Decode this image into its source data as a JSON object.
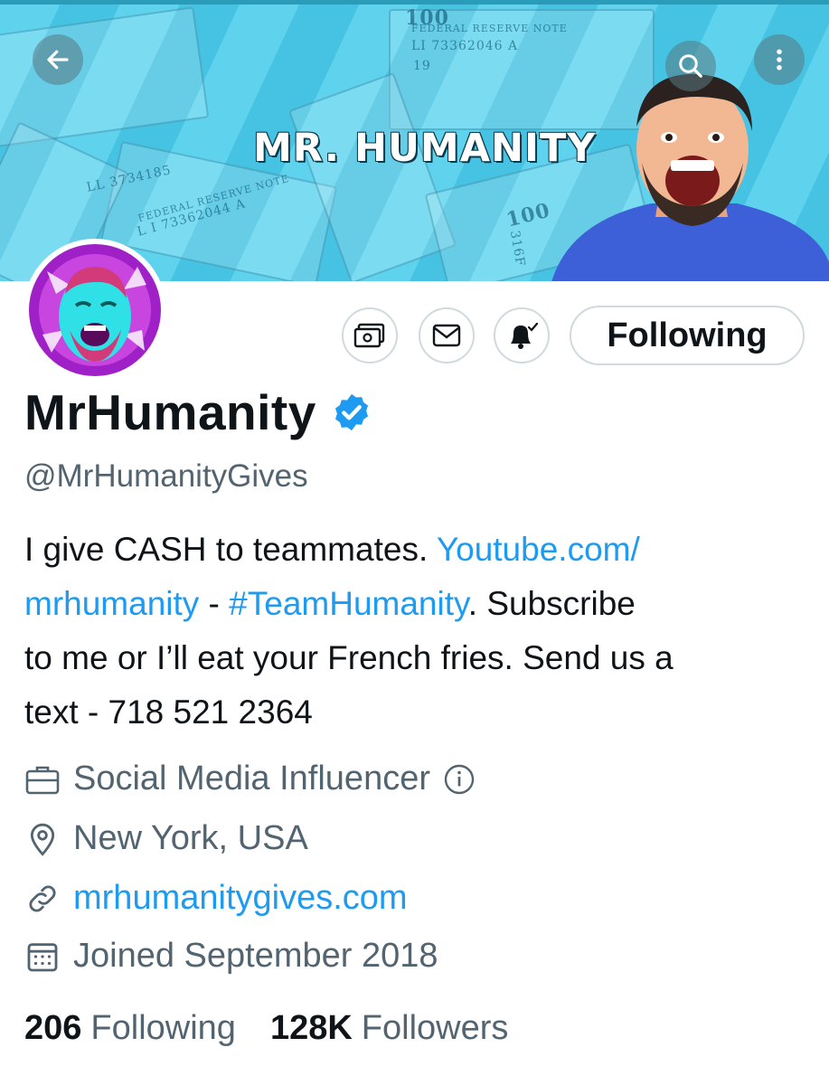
{
  "banner": {
    "title": "MR. HUMANITY",
    "bill_serials": [
      "LI 73362046 A",
      "LL 3734185",
      "L I 73362044 A",
      "19",
      "316F"
    ],
    "bill_labels": [
      "FEDERAL RESERVE NOTE",
      "FEDERAL RESERVE NOTE",
      "100",
      "100"
    ]
  },
  "top_buttons": {
    "back_icon": "arrow-left-icon",
    "search_icon": "search-icon",
    "more_icon": "more-vertical-icon"
  },
  "actions": {
    "tip_icon": "money-icon",
    "message_icon": "mail-icon",
    "notify_icon": "bell-check-icon",
    "following_label": "Following"
  },
  "profile": {
    "name": "MrHumanity",
    "handle": "@MrHumanityGives",
    "bio": {
      "t1": "I give CASH to teammates. ",
      "link1a": "Youtube.com/",
      "link1b": "mrhumanity",
      "t2": " - ",
      "hashtag": "#TeamHumanity",
      "t3": ". Subscribe",
      "line3": "to me or I’ll eat your French fries. Send us a",
      "line4": "text - 718 521 2364"
    },
    "category": "Social Media Influencer",
    "location": "New York, USA",
    "website": "mrhumanitygives.com",
    "joined": "Joined September 2018"
  },
  "stats": {
    "following_count": "206",
    "following_label": "Following",
    "followers_count": "128K",
    "followers_label": "Followers"
  },
  "colors": {
    "link": "#1d9bf0",
    "verified": "#1d9bf0",
    "banner_bg": "#5fd3ee",
    "secondary_text": "#536471"
  }
}
